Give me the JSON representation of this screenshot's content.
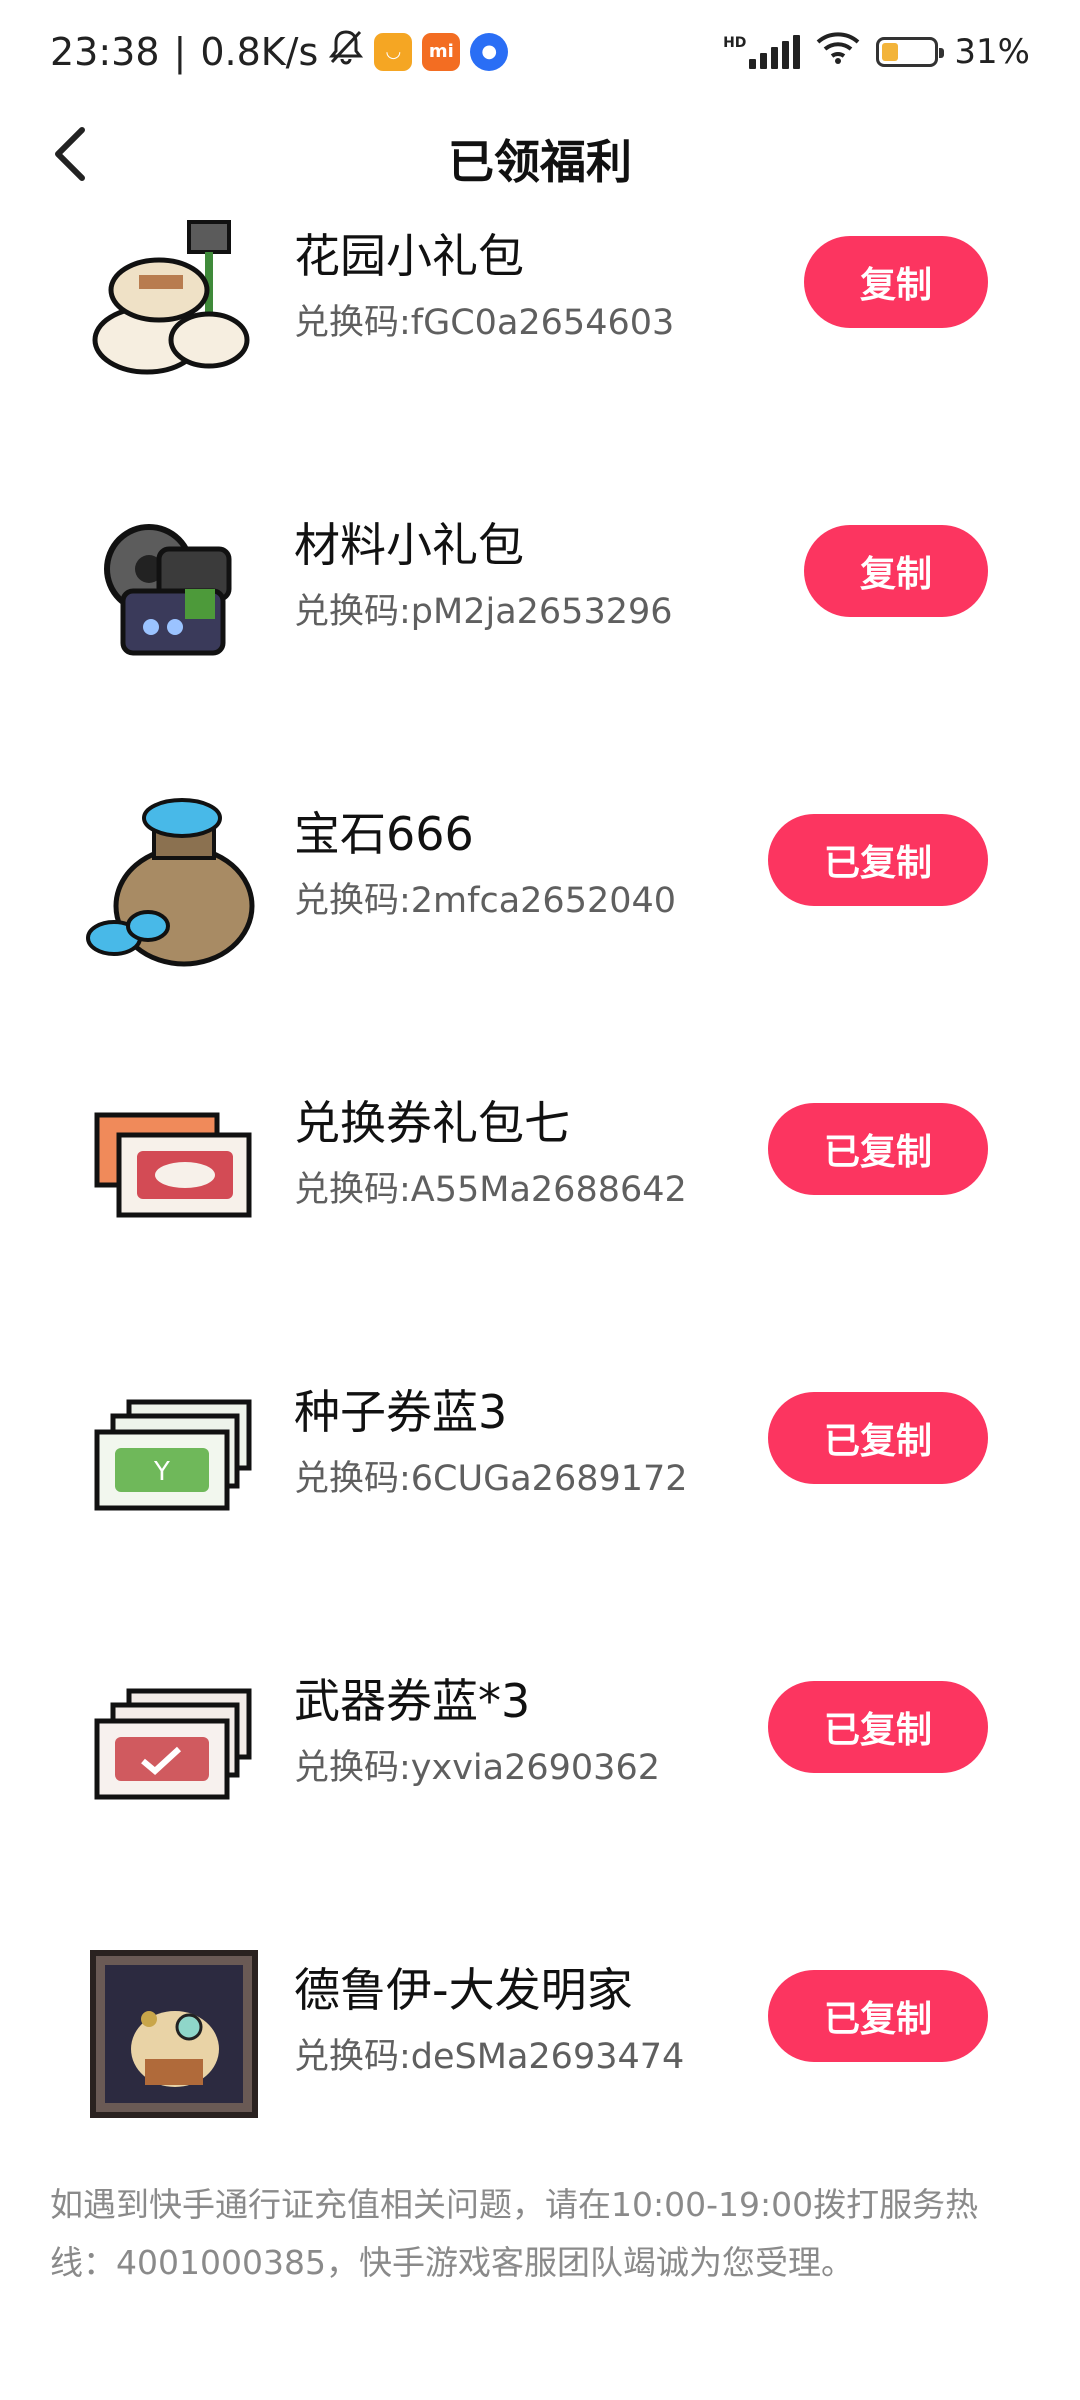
{
  "status_bar": {
    "time": "23:38",
    "separator": "|",
    "net_speed": "0.8K/s",
    "hd_label": "HD",
    "battery_percent": "31%",
    "battery_level": 0.31,
    "colors": {
      "app1": "#f5a623",
      "app2": "#f36d22",
      "app3": "#2a6ef5"
    }
  },
  "header": {
    "title": "已领福利",
    "back_icon": "chevron-left-icon"
  },
  "items": [
    {
      "name": "花园小礼包",
      "code": "兑换码:fGC0a2654603",
      "button": "复制",
      "icon": "garden-bag-icon"
    },
    {
      "name": "材料小礼包",
      "code": "兑换码:pM2ja2653296",
      "button": "复制",
      "icon": "material-bag-icon"
    },
    {
      "name": "宝石666",
      "code": "兑换码:2mfca2652040",
      "button": "已复制",
      "icon": "gem-sack-icon"
    },
    {
      "name": "兑换券礼包七",
      "code": "兑换码:A55Ma2688642",
      "button": "已复制",
      "icon": "ticket-pack-icon"
    },
    {
      "name": "种子券蓝3",
      "code": "兑换码:6CUGa2689172",
      "button": "已复制",
      "icon": "seed-ticket-icon"
    },
    {
      "name": "武器券蓝*3",
      "code": "兑换码:yxvia2690362",
      "button": "已复制",
      "icon": "weapon-ticket-icon"
    },
    {
      "name": "德鲁伊-大发明家",
      "code": "兑换码:deSMa2693474",
      "button": "已复制",
      "icon": "druid-portrait-icon"
    }
  ],
  "footer": {
    "text": "如遇到快手通行证充值相关问题，请在10:00-19:00拨打服务热线：4001000385，快手游戏客服团队竭诚为您受理。"
  },
  "colors": {
    "accent": "#fc3560",
    "secondary_text": "#5f5f5f",
    "footer_text": "#8a8a8a"
  }
}
